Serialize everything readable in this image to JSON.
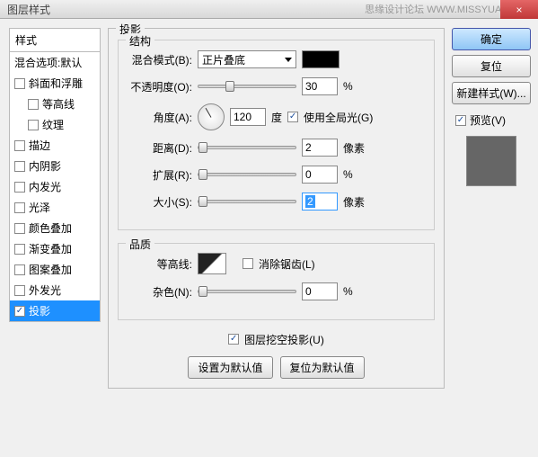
{
  "titlebar": {
    "title": "图层样式",
    "watermark": "思缘设计论坛 WWW.MISSYUAN.COM",
    "close": "×"
  },
  "left": {
    "header": "样式",
    "blend_default": "混合选项:默认",
    "items": [
      {
        "label": "斜面和浮雕",
        "checked": false,
        "indent": false
      },
      {
        "label": "等高线",
        "checked": false,
        "indent": true
      },
      {
        "label": "纹理",
        "checked": false,
        "indent": true
      },
      {
        "label": "描边",
        "checked": false,
        "indent": false
      },
      {
        "label": "内阴影",
        "checked": false,
        "indent": false
      },
      {
        "label": "内发光",
        "checked": false,
        "indent": false
      },
      {
        "label": "光泽",
        "checked": false,
        "indent": false
      },
      {
        "label": "颜色叠加",
        "checked": false,
        "indent": false
      },
      {
        "label": "渐变叠加",
        "checked": false,
        "indent": false
      },
      {
        "label": "图案叠加",
        "checked": false,
        "indent": false
      },
      {
        "label": "外发光",
        "checked": false,
        "indent": false
      },
      {
        "label": "投影",
        "checked": true,
        "indent": false,
        "selected": true
      }
    ]
  },
  "mid": {
    "panel_title": "投影",
    "structure_title": "结构",
    "blend_mode_label": "混合模式(B):",
    "blend_mode_value": "正片叠底",
    "opacity_label": "不透明度(O):",
    "opacity_value": "30",
    "percent": "%",
    "angle_label": "角度(A):",
    "angle_value": "120",
    "degree": "度",
    "global_light_label": "使用全局光(G)",
    "global_light_checked": true,
    "distance_label": "距离(D):",
    "distance_value": "2",
    "px": "像素",
    "spread_label": "扩展(R):",
    "spread_value": "0",
    "size_label": "大小(S):",
    "size_value": "2",
    "quality_title": "品质",
    "contour_label": "等高线:",
    "antialias_label": "消除锯齿(L)",
    "antialias_checked": false,
    "noise_label": "杂色(N):",
    "noise_value": "0",
    "knockout_label": "图层挖空投影(U)",
    "knockout_checked": true,
    "make_default": "设置为默认值",
    "reset_default": "复位为默认值"
  },
  "right": {
    "ok": "确定",
    "cancel": "复位",
    "new_style": "新建样式(W)...",
    "preview_label": "预览(V)",
    "preview_checked": true
  }
}
